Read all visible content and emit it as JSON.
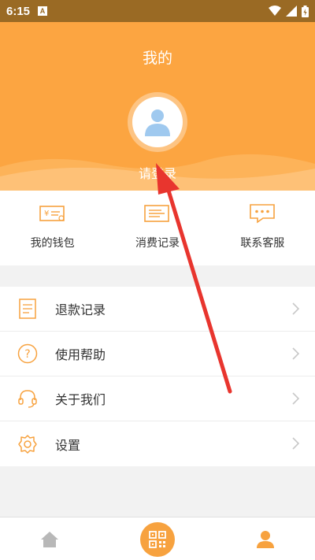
{
  "status_bar": {
    "time": "6:15",
    "notification_letter": "A"
  },
  "header": {
    "title": "我的",
    "login_prompt": "请登录",
    "background_color": "#fca541"
  },
  "quick_actions": [
    {
      "label": "我的钱包",
      "icon": "wallet-icon"
    },
    {
      "label": "消费记录",
      "icon": "receipt-icon"
    },
    {
      "label": "联系客服",
      "icon": "chat-icon"
    }
  ],
  "menu": [
    {
      "label": "退款记录",
      "icon": "document-icon"
    },
    {
      "label": "使用帮助",
      "icon": "question-icon"
    },
    {
      "label": "关于我们",
      "icon": "headset-icon"
    },
    {
      "label": "设置",
      "icon": "gear-icon"
    }
  ],
  "tabbar": [
    {
      "name": "home",
      "icon": "home-icon"
    },
    {
      "name": "scan",
      "icon": "qr-scan-icon"
    },
    {
      "name": "me",
      "icon": "user-icon",
      "active": true
    }
  ],
  "colors": {
    "accent": "#f7a23f",
    "annotation_arrow": "#e8352e"
  }
}
